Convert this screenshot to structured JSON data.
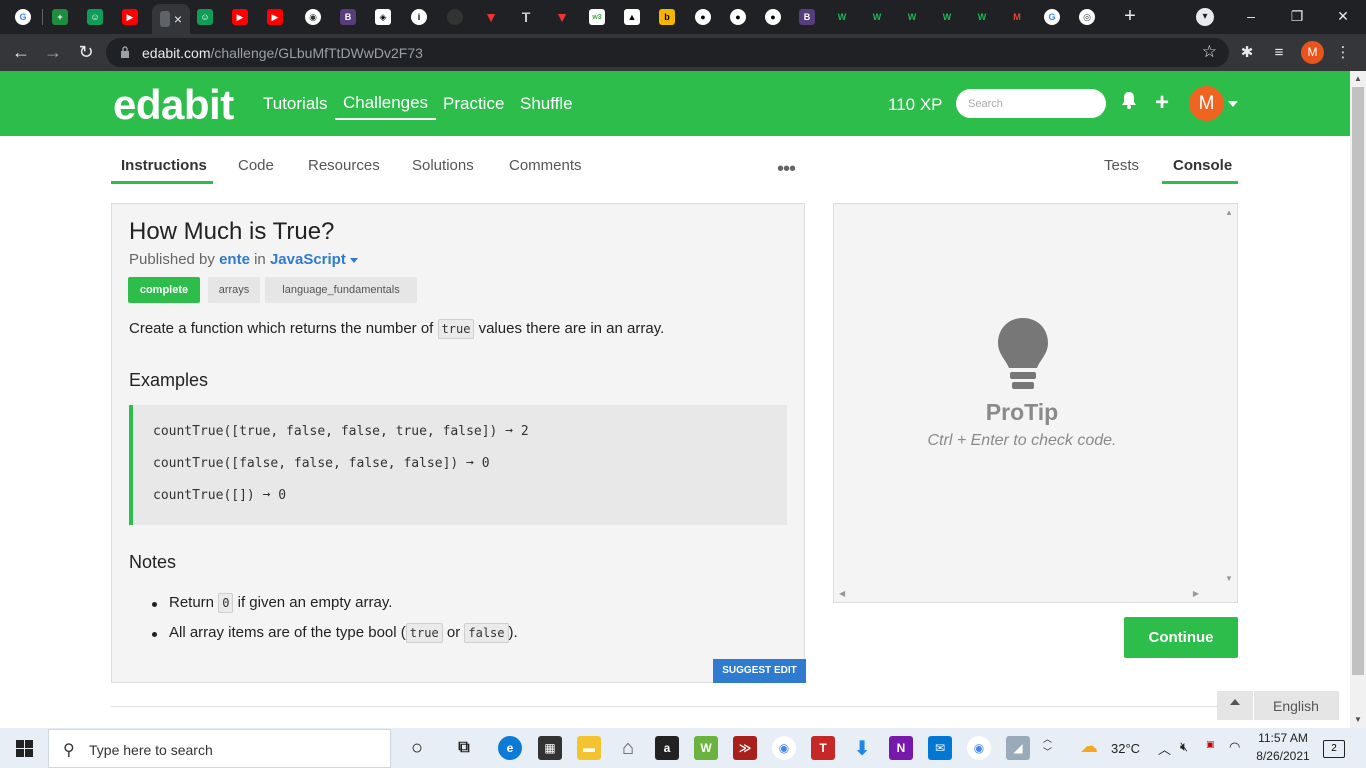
{
  "browser": {
    "tab_favicons": [
      "google",
      "gdocs",
      "gclassroom",
      "youtube",
      "active",
      "gclassroom",
      "youtube",
      "youtube",
      "lightbulb",
      "bootstrap",
      "codepen",
      "info",
      "github",
      "vercel",
      "text",
      "vercel",
      "w3schools",
      "graduation",
      "bookmark",
      "github",
      "github",
      "github",
      "bootstrap",
      "wix",
      "wix",
      "wix",
      "wix",
      "wix",
      "gmail",
      "google",
      "chrome"
    ],
    "active_tab_close": "×",
    "new_tab": "+",
    "url_domain": "edabit.com",
    "url_path": "/challenge/GLbuMfTtDWwDv2F73",
    "profile_initial": "M",
    "window_controls": [
      "–",
      "❐",
      "✕"
    ]
  },
  "site": {
    "logo": "edabit",
    "nav": [
      "Tutorials",
      "Challenges",
      "Practice",
      "Shuffle"
    ],
    "active_nav": "Challenges",
    "xp": "110 XP",
    "search_placeholder": "Search",
    "avatar_initial": "M",
    "colors": {
      "brand": "#2dbd4b",
      "link": "#2e7bcf",
      "avatar": "#f06421"
    }
  },
  "tabs": {
    "left": [
      "Instructions",
      "Code",
      "Resources",
      "Solutions",
      "Comments"
    ],
    "more": "•••",
    "right": [
      "Tests",
      "Console"
    ],
    "active_left": "Instructions",
    "active_right": "Console"
  },
  "challenge": {
    "title": "How Much is True?",
    "published_by_prefix": "Published by",
    "author": "ente",
    "in_word": "in",
    "language": "JavaScript",
    "tags": [
      "complete",
      "arrays",
      "language_fundamentals"
    ],
    "description_before": "Create a function which returns the number of",
    "description_code": "true",
    "description_after": "values there are in an array.",
    "examples_heading": "Examples",
    "examples": [
      "countTrue([true, false, false, true, false]) ➞ 2",
      "countTrue([false, false, false, false]) ➞ 0",
      "countTrue([]) ➞ 0"
    ],
    "notes_heading": "Notes",
    "note1_before": "Return",
    "note1_code": "0",
    "note1_after": "if given an empty array.",
    "note2_before": "All array items are of the type bool (",
    "note2_code_a": "true",
    "note2_mid": "or",
    "note2_code_b": "false",
    "note2_after": ").",
    "suggest_edit": "SUGGEST EDIT"
  },
  "console": {
    "protip_title": "ProTip",
    "protip_hint": "Ctrl + Enter to check code.",
    "continue_label": "Continue"
  },
  "footer": {
    "language": "English"
  },
  "taskbar": {
    "search_placeholder": "Type here to search",
    "weather": "32°C",
    "time": "11:57 AM",
    "date": "8/26/2021",
    "notifications": "2"
  }
}
